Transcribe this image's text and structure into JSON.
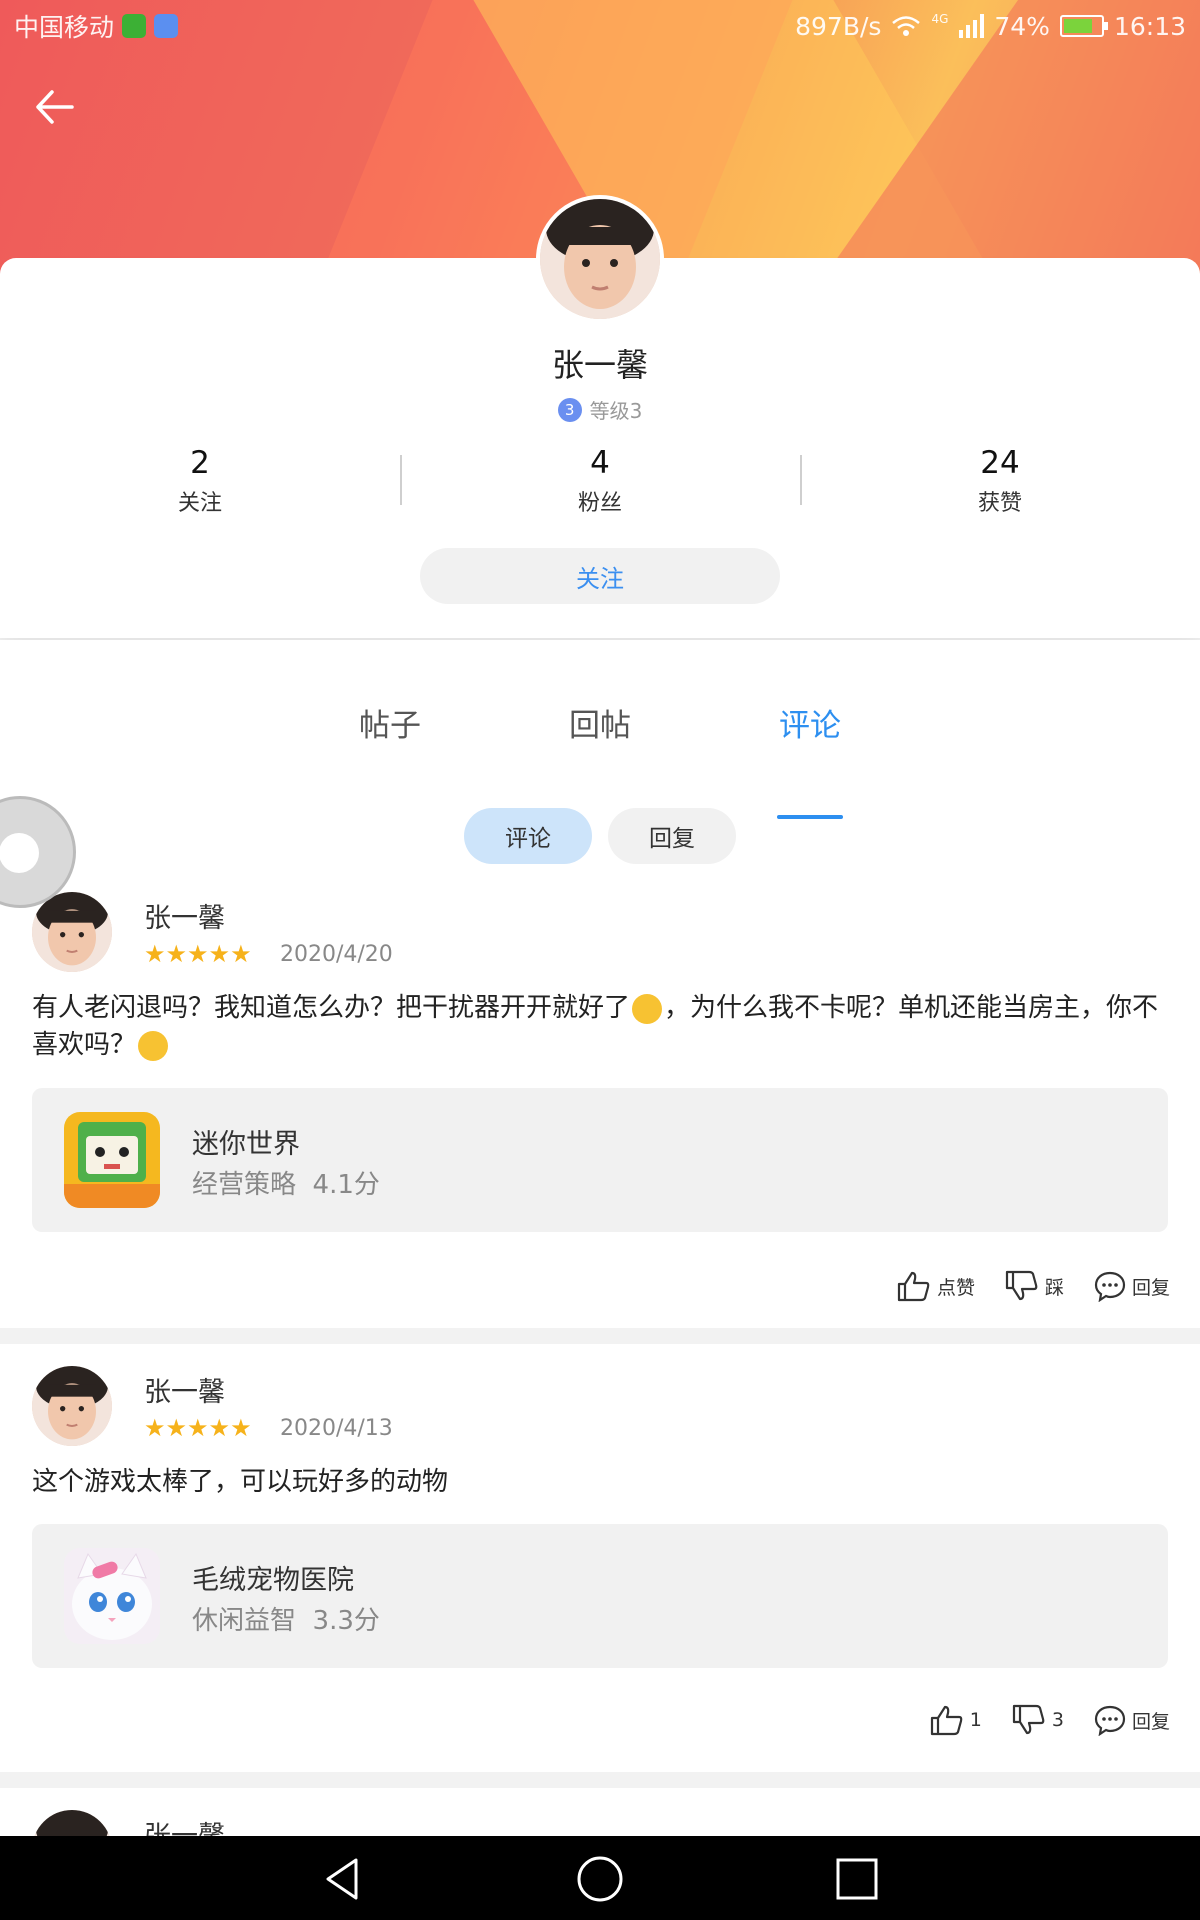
{
  "status_bar": {
    "carrier": "中国移动",
    "speed": "897B/s",
    "network": "4G",
    "battery": "74%",
    "time": "16:13"
  },
  "profile": {
    "name": "张一馨",
    "level_badge": "3",
    "level": "等级3",
    "stats": [
      {
        "num": "2",
        "label": "关注"
      },
      {
        "num": "4",
        "label": "粉丝"
      },
      {
        "num": "24",
        "label": "获赞"
      }
    ],
    "follow_label": "关注"
  },
  "tabs": [
    "帖子",
    "回帖",
    "评论"
  ],
  "active_tab": "评论",
  "subtabs": [
    "评论",
    "回复"
  ],
  "comments": [
    {
      "user": "张一馨",
      "stars": "★★★★★",
      "rating": 5,
      "date": "2020/4/20",
      "text_a": "有人老闪退吗？我知道怎么办？把干扰器开开就好了",
      "text_b": "，为什么我不卡呢？单机还能当房主，你不喜欢吗？",
      "game": {
        "name": "迷你世界",
        "category": "经营策略",
        "score": "4.1分"
      },
      "like": "点赞",
      "dislike": "踩",
      "reply": "回复"
    },
    {
      "user": "张一馨",
      "stars": "★★★★★",
      "rating": 5,
      "date": "2020/4/13",
      "text": "这个游戏太棒了，可以玩好多的动物",
      "game": {
        "name": "毛绒宠物医院",
        "category": "休闲益智",
        "score": "3.3分"
      },
      "like": "1",
      "dislike": "3",
      "reply": "回复"
    },
    {
      "user": "张一馨"
    }
  ],
  "colors": {
    "accent": "#2d8ff0",
    "star": "#f6b21b",
    "banner_start": "#ef5a5a",
    "banner_end": "#fbbf5a"
  }
}
